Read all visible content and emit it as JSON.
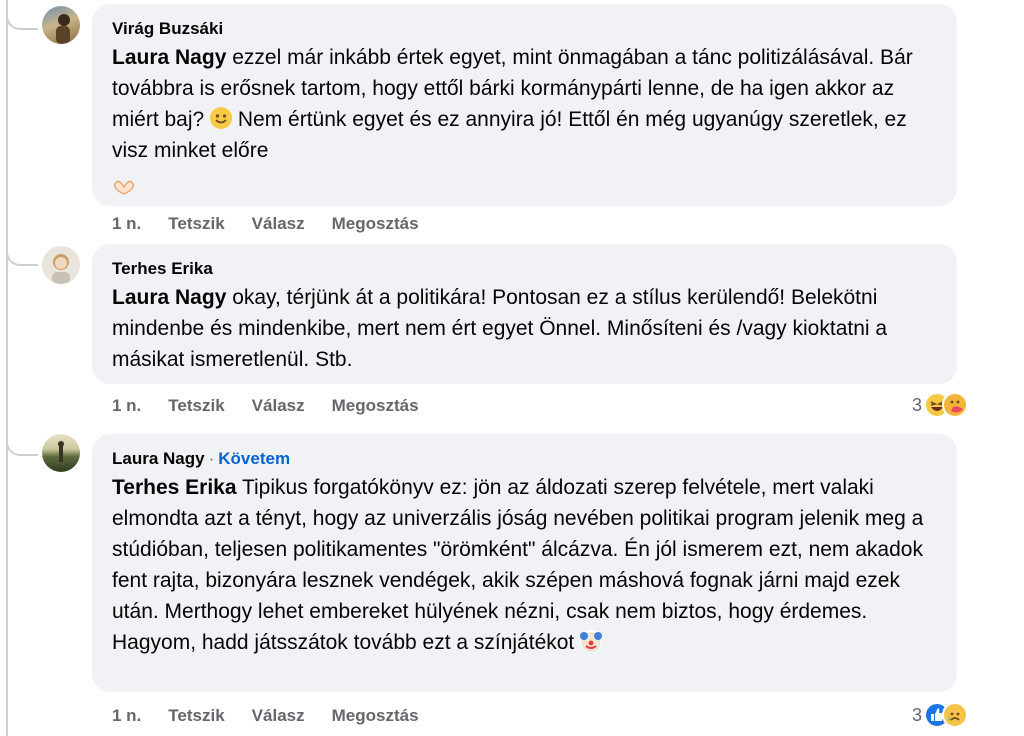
{
  "comments": [
    {
      "author": "Virág Buzsáki",
      "mention": "Laura Nagy",
      "text": " ezzel már inkább értek egyet, mint önmagában a tánc politizálásával. Bár továbbra is erősnek tartom, hogy ettől bárki kormánypárti lenne, de ha igen akkor az miért baj? ",
      "text2": " Nem értünk egyet és ez annyira jó! Ettől én még ugyanúgy szeretlek, ez visz minket előre",
      "time": "1 n.",
      "like": "Tetszik",
      "reply": "Válasz",
      "share": "Megosztás",
      "avatar_color": "#8a7a5c"
    },
    {
      "author": "Terhes Erika",
      "mention": "Laura Nagy",
      "text": " okay, térjünk át a politikára! Pontosan ez a stílus kerülendő! Belekötni mindenbe és mindenkibe, mert nem ért egyet Önnel. Minősíteni és /vagy kioktatni a másikat ismeretlenül. Stb.",
      "time": "1 n.",
      "like": "Tetszik",
      "reply": "Válasz",
      "share": "Megosztás",
      "reaction_count": "3",
      "reaction_icons": [
        "haha-icon",
        "care-icon"
      ],
      "avatar_color": "#d9cfc0"
    },
    {
      "author": "Laura Nagy",
      "separator": "·",
      "follow": "Követem",
      "mention": "Terhes Erika",
      "text": " Tipikus forgatókönyv ez: jön az áldozati szerep felvétele, mert valaki elmondta azt a tényt, hogy az univerzális jóság nevében politikai program jelenik meg a stúdióban, teljesen politikamentes \"örömként\" álcázva. Én jól ismerem ezt, nem akadok fent rajta, bizonyára lesznek vendégek, akik szépen máshová fognak járni majd ezek után. Merthogy lehet embereket hülyének nézni, csak nem biztos, hogy érdemes. Hagyom, hadd játsszátok tovább ezt a színjátékot",
      "time": "1 n.",
      "like": "Tetszik",
      "reply": "Válasz",
      "share": "Megosztás",
      "reaction_count": "3",
      "reaction_icons": [
        "like-icon",
        "sad-icon"
      ],
      "avatar_color": "#5b6a3e"
    }
  ],
  "colors": {
    "bubble": "#f0f2f5",
    "meta_text": "#65676b",
    "follow": "#0064d1"
  }
}
